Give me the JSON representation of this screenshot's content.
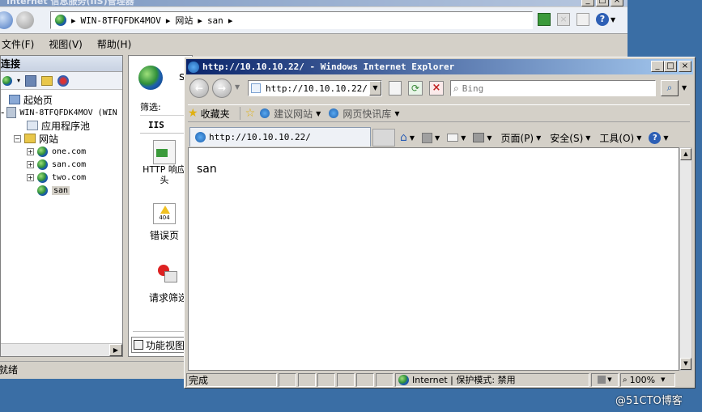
{
  "iis": {
    "title": "Internet 信息服务(IIS)管理器",
    "breadcrumb": [
      "WIN-8TFQFDK4MOV",
      "网站",
      "san"
    ],
    "menu": [
      "文件(F)",
      "视图(V)",
      "帮助(H)"
    ],
    "conn_title": "连接",
    "tree": {
      "start": "起始页",
      "server": "WIN-8TFQFDK4MOV (WIN",
      "apppools": "应用程序池",
      "sites": "网站",
      "site1": "one.com",
      "site2": "san.com",
      "site3": "two.com",
      "site4": "san"
    },
    "home_label": "s",
    "filter_label": "筛选:",
    "group_label": "IIS",
    "features": [
      {
        "label": "HTTP 响应头",
        "icon": "http-headers-icon"
      },
      {
        "label": "错误页",
        "icon": "error-pages-icon"
      },
      {
        "label": "请求筛选",
        "icon": "request-filtering-icon"
      }
    ],
    "http_line1": "HTTP 响应",
    "http_line2": "头",
    "feature_view_tab": "功能视图",
    "status": "就绪"
  },
  "ie": {
    "title": "http://10.10.10.22/ - Windows Internet Explorer",
    "address": "http://10.10.10.22/",
    "search_placeholder": "Bing",
    "favorites_label": "收藏夹",
    "suggested_sites": "建议网站",
    "web_slice": "网页快讯库",
    "tab_title": "http://10.10.10.22/",
    "page_menu": "页面(P)",
    "safety_menu": "安全(S)",
    "tools_menu": "工具(O)",
    "content_text": "san",
    "status_done": "完成",
    "zone": "Internet | 保护模式: 禁用",
    "zoom": "100%"
  },
  "watermark": "@51CTO博客"
}
